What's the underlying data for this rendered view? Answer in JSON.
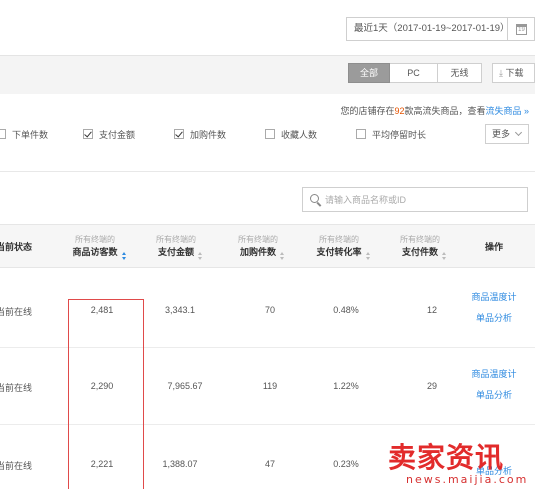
{
  "date_picker": {
    "range_label": "最近1天（2017-01-19~2017-01-19）",
    "calendar_icon": "calendar-icon",
    "calendar_day": "19"
  },
  "device_tabs": [
    "全部",
    "PC",
    "无线"
  ],
  "download_label": "下载",
  "notice": {
    "prefix": "您的店铺存在",
    "count": "92",
    "middle": "款高流失商品，查看",
    "link": "流失商品 »"
  },
  "indicators": [
    {
      "label": "下单件数",
      "checked": false
    },
    {
      "label": "支付金额",
      "checked": true
    },
    {
      "label": "加购件数",
      "checked": true
    },
    {
      "label": "收藏人数",
      "checked": false
    },
    {
      "label": "平均停留时长",
      "checked": false
    }
  ],
  "more_label": "更多",
  "search": {
    "placeholder": "请输入商品名称或ID"
  },
  "table": {
    "status_header": "当前状态",
    "metric_headers": [
      {
        "line1": "所有终端的",
        "line2": "商品访客数"
      },
      {
        "line1": "所有终端的",
        "line2": "支付金额"
      },
      {
        "line1": "所有终端的",
        "line2": "加购件数"
      },
      {
        "line1": "所有终端的",
        "line2": "支付转化率"
      },
      {
        "line1": "所有终端的",
        "line2": "支付件数"
      }
    ],
    "action_header": "操作",
    "rows": [
      {
        "status": "当前在线",
        "visitors": "2,481",
        "amount": "3,343.1",
        "cart": "70",
        "conversion": "0.48%",
        "paid_qty": "12",
        "actions": [
          "商品温度计",
          "单品分析"
        ]
      },
      {
        "status": "当前在线",
        "visitors": "2,290",
        "amount": "7,965.67",
        "cart": "119",
        "conversion": "1.22%",
        "paid_qty": "29",
        "actions": [
          "商品温度计",
          "单品分析"
        ]
      },
      {
        "status": "当前在线",
        "visitors": "2,221",
        "amount": "1,388.07",
        "cart": "47",
        "conversion": "0.23%",
        "paid_qty": "",
        "actions": [
          "",
          "单品分析"
        ]
      }
    ]
  },
  "watermark": {
    "main": "卖家资讯",
    "sub": "news.maijia.com"
  },
  "colors": {
    "link": "#2d8ae0",
    "highlight_border": "#e04a4a",
    "watermark": "#e01a1a",
    "active_tab": "#9b9b9b"
  }
}
